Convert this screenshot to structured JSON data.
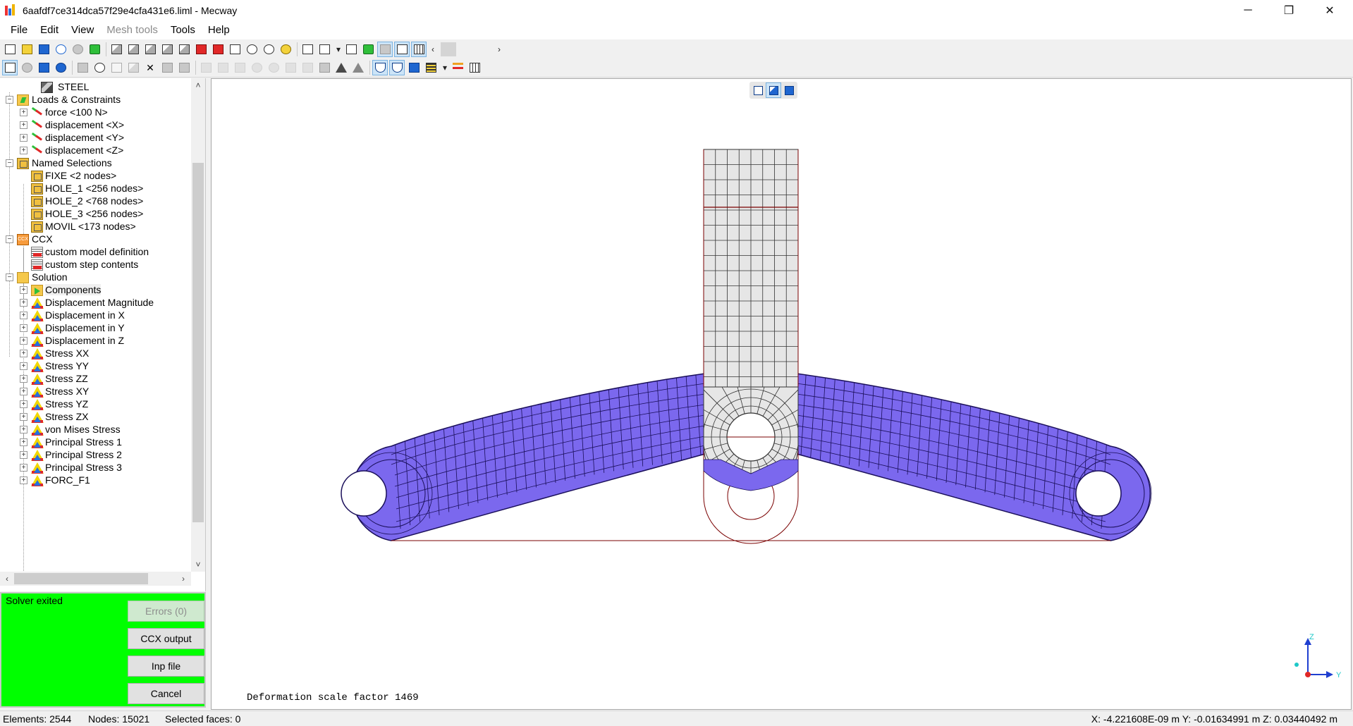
{
  "window": {
    "title": "6aafdf7ce314dca57f29e4cfa431e6.liml - Mecway",
    "minimize_glyph": "─",
    "restore_glyph": "❐",
    "close_glyph": "✕"
  },
  "menu": {
    "items": [
      {
        "label": "File",
        "enabled": true
      },
      {
        "label": "Edit",
        "enabled": true
      },
      {
        "label": "View",
        "enabled": true
      },
      {
        "label": "Mesh tools",
        "enabled": false
      },
      {
        "label": "Tools",
        "enabled": true
      },
      {
        "label": "Help",
        "enabled": true
      }
    ]
  },
  "toolbar": {
    "scroll_left": "‹",
    "scroll_right": "›"
  },
  "tree": {
    "expander_plus": "+",
    "expander_minus": "−",
    "scroll_up": "˄",
    "scroll_down": "˅",
    "scroll_left": "‹",
    "scroll_right": "›",
    "rows": [
      {
        "label": "STEEL",
        "icon": "material-icon",
        "level": 2,
        "expander": "none"
      },
      {
        "label": "Loads & Constraints",
        "icon": "loads-folder-icon",
        "level": 1,
        "expander": "minus"
      },
      {
        "label": "force <100 N>",
        "icon": "force-icon",
        "level": 2,
        "expander": "plus"
      },
      {
        "label": "displacement <X>",
        "icon": "displacement-icon",
        "level": 2,
        "expander": "plus"
      },
      {
        "label": "displacement <Y>",
        "icon": "displacement-icon",
        "level": 2,
        "expander": "plus"
      },
      {
        "label": "displacement <Z>",
        "icon": "displacement-icon",
        "level": 2,
        "expander": "plus"
      },
      {
        "label": "Named Selections",
        "icon": "named-selections-folder-icon",
        "level": 1,
        "expander": "minus"
      },
      {
        "label": "FIXE <2 nodes>",
        "icon": "named-selection-icon",
        "level": 2,
        "expander": "none"
      },
      {
        "label": "HOLE_1 <256 nodes>",
        "icon": "named-selection-icon",
        "level": 2,
        "expander": "none"
      },
      {
        "label": "HOLE_2 <768 nodes>",
        "icon": "named-selection-icon",
        "level": 2,
        "expander": "none"
      },
      {
        "label": "HOLE_3 <256 nodes>",
        "icon": "named-selection-icon",
        "level": 2,
        "expander": "none"
      },
      {
        "label": "MOVIL <173 nodes>",
        "icon": "named-selection-icon",
        "level": 2,
        "expander": "none"
      },
      {
        "label": "CCX",
        "icon": "ccx-icon",
        "level": 1,
        "expander": "minus"
      },
      {
        "label": "custom model definition",
        "icon": "ccx-document-icon",
        "level": 2,
        "expander": "none"
      },
      {
        "label": "custom step contents",
        "icon": "ccx-document-icon",
        "level": 2,
        "expander": "none"
      },
      {
        "label": "Solution",
        "icon": "solution-folder-icon",
        "level": 1,
        "expander": "minus"
      },
      {
        "label": "Components",
        "icon": "components-folder-icon",
        "level": 2,
        "expander": "plus",
        "selected": true
      },
      {
        "label": "Displacement Magnitude",
        "icon": "contour-icon",
        "level": 2,
        "expander": "plus"
      },
      {
        "label": "Displacement in X",
        "icon": "contour-icon",
        "level": 2,
        "expander": "plus"
      },
      {
        "label": "Displacement in Y",
        "icon": "contour-icon",
        "level": 2,
        "expander": "plus"
      },
      {
        "label": "Displacement in Z",
        "icon": "contour-icon",
        "level": 2,
        "expander": "plus"
      },
      {
        "label": "Stress XX",
        "icon": "contour-icon",
        "level": 2,
        "expander": "plus"
      },
      {
        "label": "Stress YY",
        "icon": "contour-icon",
        "level": 2,
        "expander": "plus"
      },
      {
        "label": "Stress ZZ",
        "icon": "contour-icon",
        "level": 2,
        "expander": "plus"
      },
      {
        "label": "Stress XY",
        "icon": "contour-icon",
        "level": 2,
        "expander": "plus"
      },
      {
        "label": "Stress YZ",
        "icon": "contour-icon",
        "level": 2,
        "expander": "plus"
      },
      {
        "label": "Stress ZX",
        "icon": "contour-icon",
        "level": 2,
        "expander": "plus"
      },
      {
        "label": "von Mises Stress",
        "icon": "contour-icon",
        "level": 2,
        "expander": "plus"
      },
      {
        "label": "Principal Stress 1",
        "icon": "contour-icon",
        "level": 2,
        "expander": "plus"
      },
      {
        "label": "Principal Stress 2",
        "icon": "contour-icon",
        "level": 2,
        "expander": "plus"
      },
      {
        "label": "Principal Stress 3",
        "icon": "contour-icon",
        "level": 2,
        "expander": "plus"
      },
      {
        "label": "FORC_F1",
        "icon": "contour-icon",
        "level": 2,
        "expander": "plus"
      }
    ]
  },
  "solver": {
    "status": "Solver exited",
    "errors_label": "Errors (0)",
    "ccx_output_label": "CCX output",
    "inp_file_label": "Inp file",
    "cancel_label": "Cancel",
    "background_color": "#00ff00"
  },
  "viewport": {
    "deformation_label": "Deformation scale factor 1469",
    "mesh_fill_color": "#7b68ee",
    "mesh_gray_color": "#e6e6e6",
    "outline_color": "#7a0000",
    "axis_labels": {
      "z": "Z",
      "y": "Y"
    }
  },
  "statusbar": {
    "elements": "Elements: 2544",
    "nodes": "Nodes: 15021",
    "selected_faces": "Selected faces: 0",
    "coordinates": "X: -4.221608E-09 m Y: -0.01634991 m Z: 0.03440492 m"
  }
}
